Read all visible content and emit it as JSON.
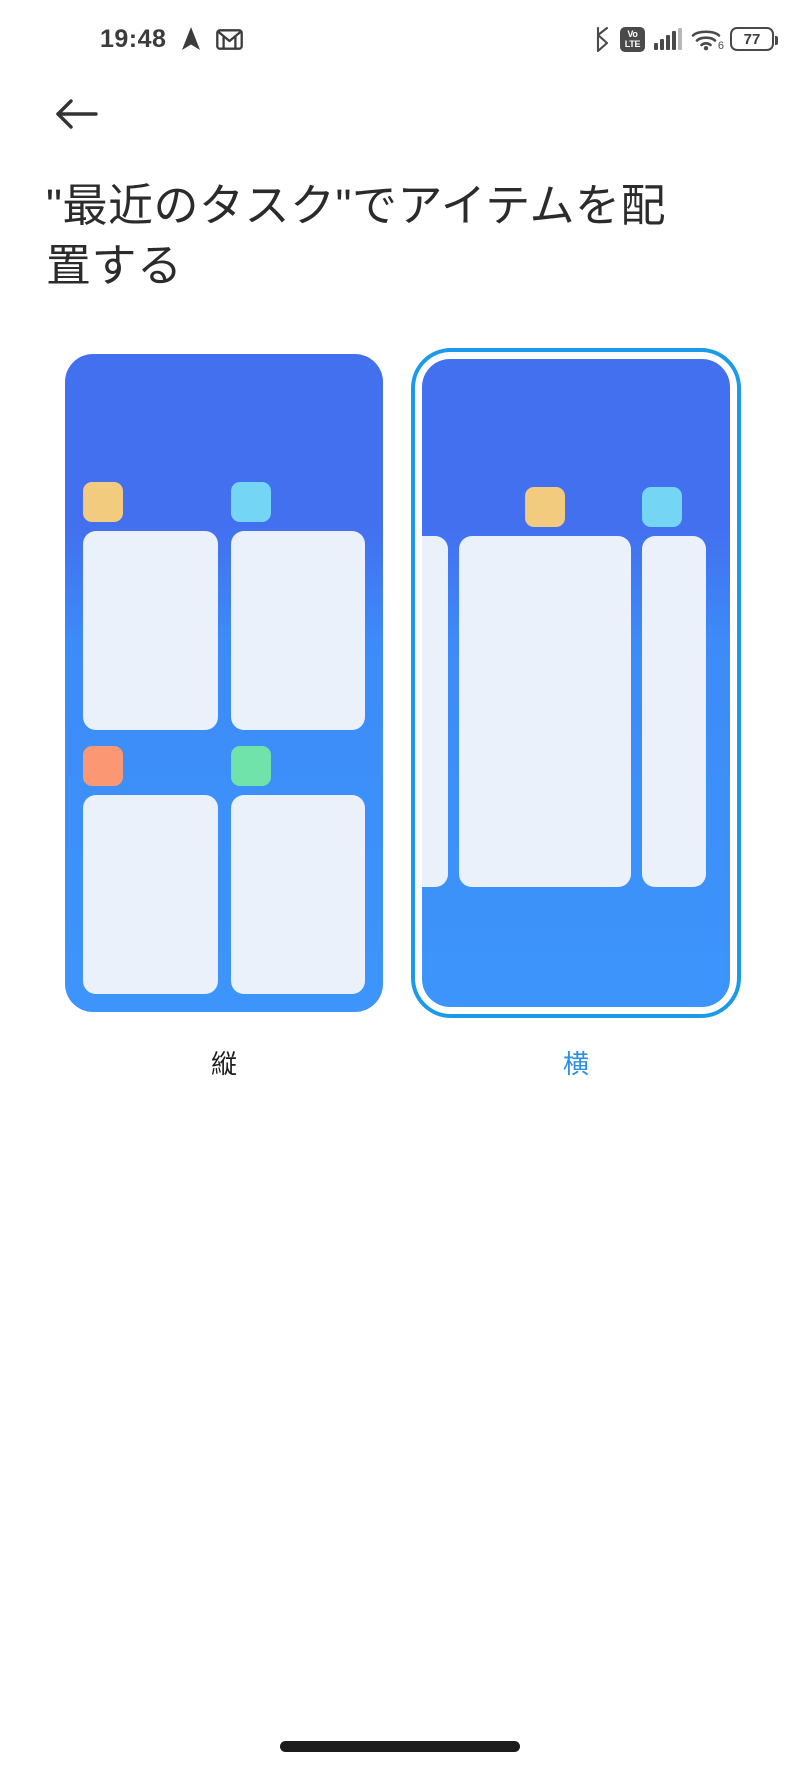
{
  "statusbar": {
    "clock": "19:48",
    "icons_left": [
      "navigation-arrow-icon",
      "gmail-icon"
    ],
    "icons_right": [
      "bluetooth-icon",
      "volte-icon",
      "signal-bars-icon",
      "wifi-6-icon",
      "battery-icon"
    ],
    "volte_top": "Vo",
    "volte_bottom": "LTE",
    "wifi_generation": "6",
    "battery_percent": "77",
    "icon_color": "#4a4a4a"
  },
  "nav": {
    "back_icon": "arrow-left-icon"
  },
  "page": {
    "title": "\"最近のタスク\"でアイテムを配置する"
  },
  "options": [
    {
      "id": "portrait",
      "label": "縦",
      "selected": false,
      "app_icon_colors": [
        "#f3cb7e",
        "#74d5f5",
        "#fb9873",
        "#70e3ab"
      ]
    },
    {
      "id": "landscape",
      "label": "横",
      "selected": true,
      "app_icon_colors": [
        "#f3cb7e",
        "#74d5f5"
      ]
    }
  ],
  "theme": {
    "accent": "#1a9ae8",
    "selected_label_color": "#2e8fe0",
    "label_color": "#1b1b1b",
    "preview_blue_top": "#4370ef",
    "preview_blue_bottom": "#3d95fb",
    "task_card_fill": "#eaf1fb",
    "title_color": "#2b2b2b",
    "page_background": "#ffffff"
  },
  "home_indicator": "home-indicator"
}
